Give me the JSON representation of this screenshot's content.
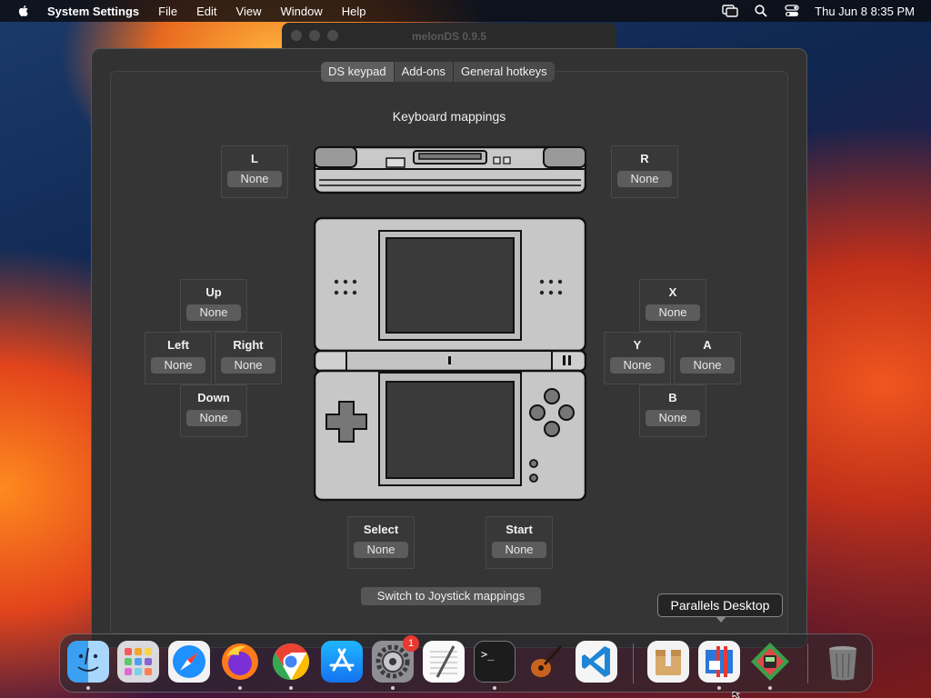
{
  "menubar": {
    "app_name": "System Settings",
    "items": [
      "File",
      "Edit",
      "View",
      "Window",
      "Help"
    ],
    "clock": "Thu Jun 8  8:35 PM"
  },
  "back_window": {
    "title": "melonDS 0.9.5"
  },
  "tabs": [
    "DS keypad",
    "Add-ons",
    "General hotkeys"
  ],
  "section_title": "Keyboard mappings",
  "mappings": {
    "l": {
      "label": "L",
      "value": "None"
    },
    "r": {
      "label": "R",
      "value": "None"
    },
    "up": {
      "label": "Up",
      "value": "None"
    },
    "left": {
      "label": "Left",
      "value": "None"
    },
    "right": {
      "label": "Right",
      "value": "None"
    },
    "down": {
      "label": "Down",
      "value": "None"
    },
    "x": {
      "label": "X",
      "value": "None"
    },
    "y": {
      "label": "Y",
      "value": "None"
    },
    "a": {
      "label": "A",
      "value": "None"
    },
    "b": {
      "label": "B",
      "value": "None"
    },
    "select": {
      "label": "Select",
      "value": "None"
    },
    "start": {
      "label": "Start",
      "value": "None"
    }
  },
  "switch_button": "Switch to Joystick mappings",
  "tooltip": "Parallels Desktop",
  "dock": {
    "system_settings_badge": "1",
    "apps": [
      "Finder",
      "Launchpad",
      "Safari",
      "Firefox",
      "Chrome",
      "App Store",
      "System Settings",
      "TextEdit",
      "Terminal",
      "GarageBand",
      "VS Code",
      "Archive Utility",
      "Parallels Desktop",
      "melonDS",
      "Trash"
    ]
  },
  "colors": {
    "accent_red": "#e8392f",
    "panel_bg": "#353535",
    "button_bg": "#5c5c5c"
  }
}
